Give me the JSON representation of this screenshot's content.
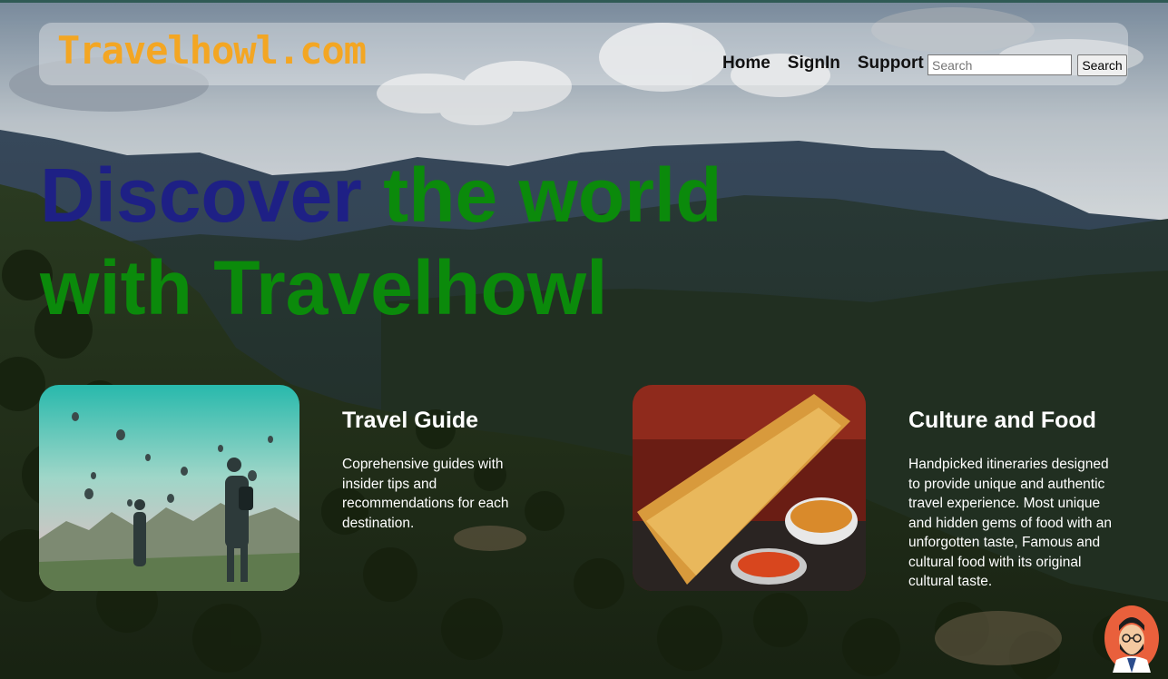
{
  "brand": {
    "logo_text": "Travelhowl.com"
  },
  "nav": {
    "home": "Home",
    "signin": "SignIn",
    "support": "Support"
  },
  "search": {
    "placeholder": "Search",
    "button_label": "Search"
  },
  "headline": {
    "part_blue": "Discover",
    "part_green": "the world with Travelhowl"
  },
  "features": [
    {
      "title": "Travel Guide",
      "text": "Coprehensive guides with insider tips and recommendations for each destination."
    },
    {
      "title": "Culture and Food",
      "text": "Handpicked itineraries designed to provide unique and authentic travel experience. Most unique and hidden gems of food with an unforgotten taste, Famous and cultural food with its original cultural taste."
    }
  ],
  "colors": {
    "logo": "#f3a623",
    "headline_blue": "#1e2085",
    "headline_green": "#0b8a0b",
    "card_text": "#ffffff"
  },
  "icons": {
    "avatar": "support-avatar-icon"
  }
}
